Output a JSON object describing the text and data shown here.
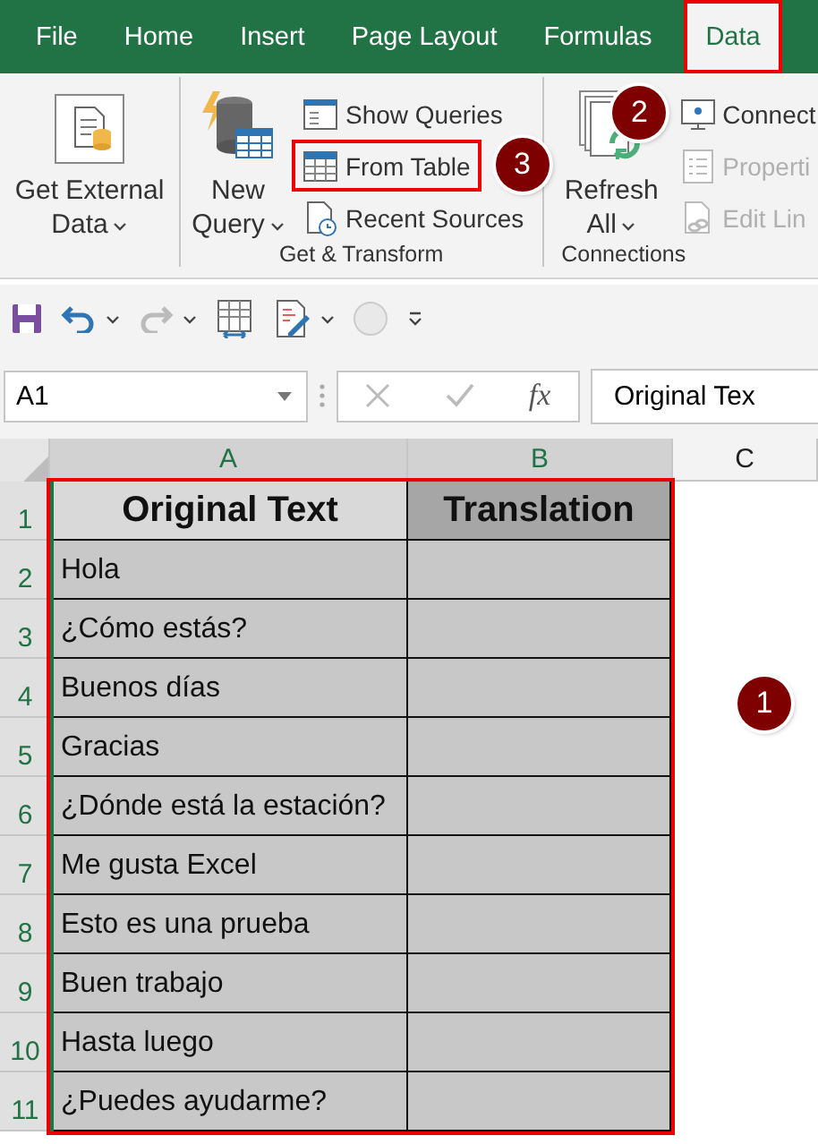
{
  "tabs": [
    {
      "label": "File",
      "selected": false,
      "highlighted": false
    },
    {
      "label": "Home",
      "selected": false,
      "highlighted": false
    },
    {
      "label": "Insert",
      "selected": false,
      "highlighted": false
    },
    {
      "label": "Page Layout",
      "selected": false,
      "highlighted": false
    },
    {
      "label": "Formulas",
      "selected": false,
      "highlighted": false
    },
    {
      "label": "Data",
      "selected": true,
      "highlighted": true,
      "callout": "2"
    }
  ],
  "ribbon": {
    "groups": [
      {
        "items": [
          {
            "kind": "large",
            "label": "Get External Data",
            "dropdown": true
          }
        ]
      },
      {
        "label": "Get & Transform",
        "items": [
          {
            "kind": "large",
            "label": "New Query",
            "dropdown": true
          },
          {
            "kind": "stack",
            "items": [
              {
                "label": "Show Queries",
                "disabled": false,
                "highlighted": false
              },
              {
                "label": "From Table",
                "disabled": false,
                "highlighted": true,
                "callout": "3"
              },
              {
                "label": "Recent Sources",
                "disabled": false,
                "highlighted": false
              }
            ]
          }
        ]
      },
      {
        "label": "Connections",
        "items": [
          {
            "kind": "large",
            "label": "Refresh All",
            "dropdown": true
          },
          {
            "kind": "stack",
            "items": [
              {
                "label": "Connect",
                "disabled": false,
                "highlighted": false
              },
              {
                "label": "Properti",
                "disabled": true,
                "highlighted": false
              },
              {
                "label": "Edit Lin",
                "disabled": true,
                "highlighted": false
              }
            ]
          }
        ]
      }
    ]
  },
  "formula_bar": {
    "name_box": "A1",
    "fx": "fx",
    "value": "Original Tex"
  },
  "sheet": {
    "columns": [
      {
        "label": "A",
        "selected": true
      },
      {
        "label": "B",
        "selected": true
      },
      {
        "label": "C",
        "selected": false
      }
    ],
    "highlighted": true,
    "callout": "1",
    "rows": [
      {
        "number": "1",
        "cells": [
          "Original Text",
          "Translation"
        ]
      },
      {
        "number": "2",
        "cells": [
          "Hola",
          ""
        ]
      },
      {
        "number": "3",
        "cells": [
          "¿Cómo estás?",
          ""
        ]
      },
      {
        "number": "4",
        "cells": [
          "Buenos días",
          ""
        ]
      },
      {
        "number": "5",
        "cells": [
          "Gracias",
          ""
        ]
      },
      {
        "number": "6",
        "cells": [
          "¿Dónde está la estación?",
          ""
        ]
      },
      {
        "number": "7",
        "cells": [
          "Me gusta Excel",
          ""
        ]
      },
      {
        "number": "8",
        "cells": [
          "Esto es una prueba",
          ""
        ]
      },
      {
        "number": "9",
        "cells": [
          "Buen trabajo",
          ""
        ]
      },
      {
        "number": "10",
        "cells": [
          "Hasta luego",
          ""
        ]
      },
      {
        "number": "11",
        "cells": [
          "¿Puedes ayudarme?",
          ""
        ]
      }
    ]
  }
}
